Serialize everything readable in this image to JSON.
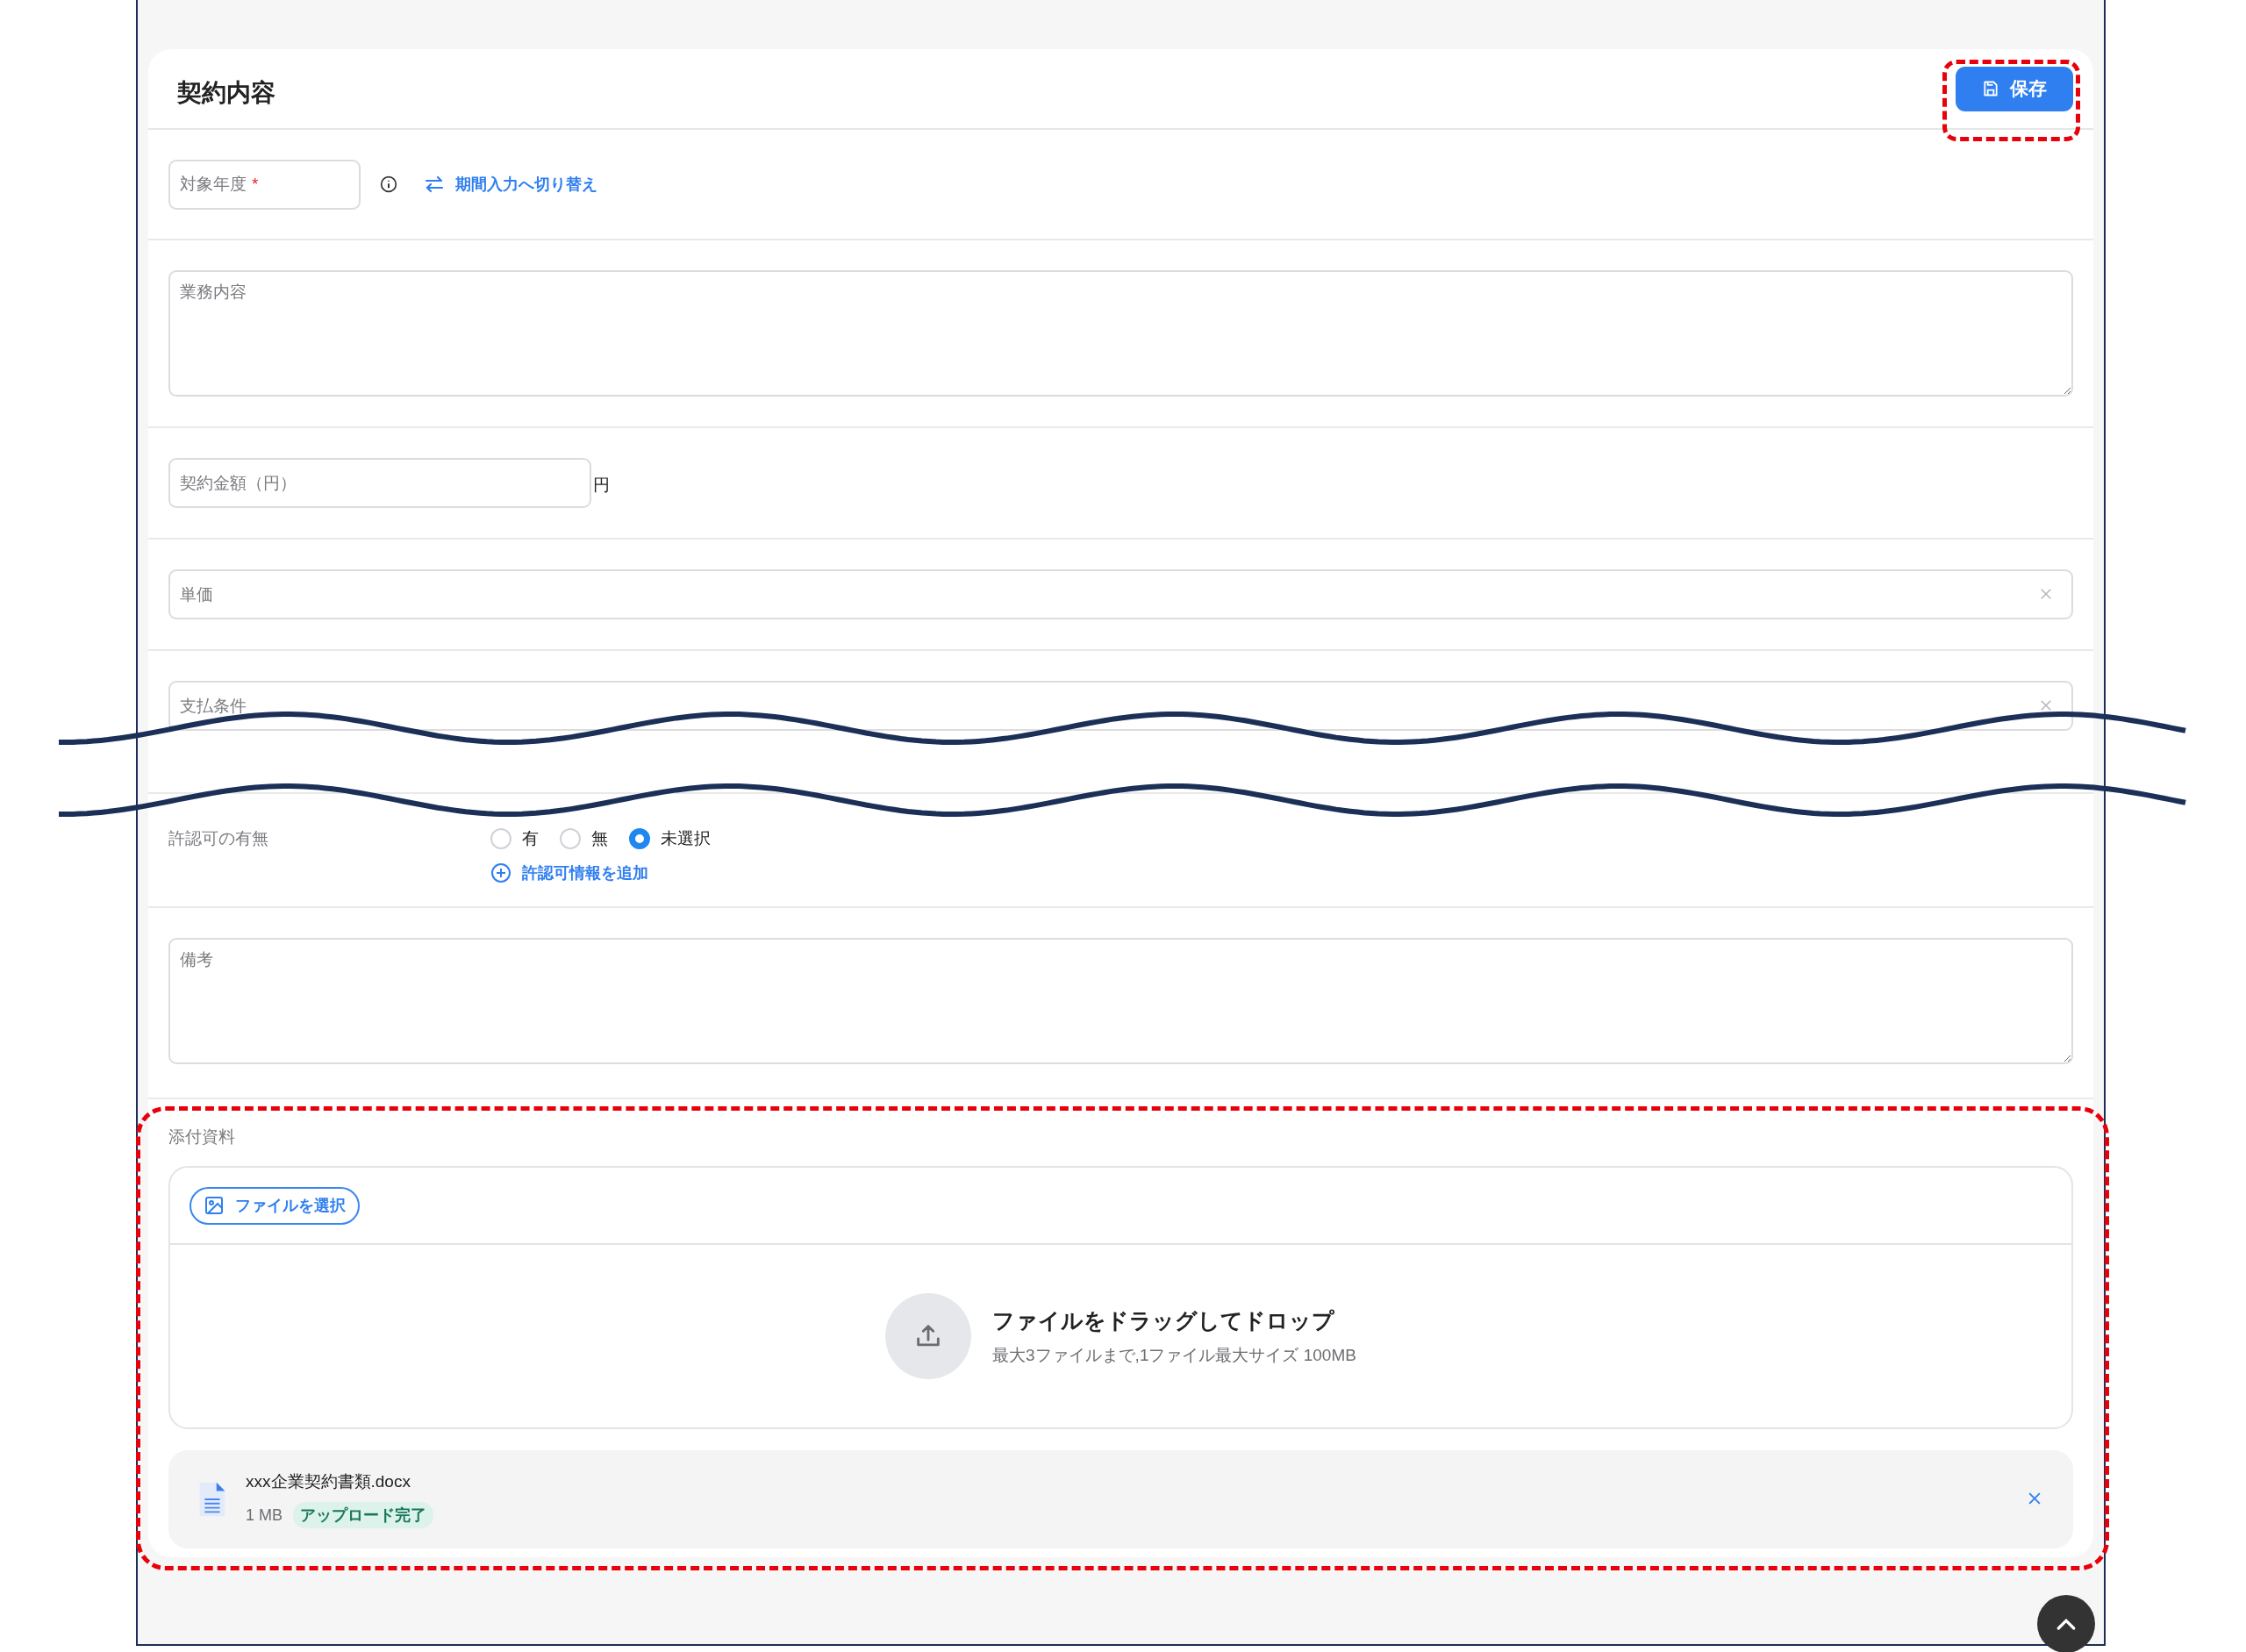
{
  "section": {
    "title": "契約内容",
    "save_button": "保存"
  },
  "target_year": {
    "placeholder": "対象年度",
    "required_mark": "*",
    "toggle_link": "期間入力へ切り替え"
  },
  "business_description": {
    "placeholder": "業務内容"
  },
  "contract_amount": {
    "placeholder": "契約金額（円）",
    "unit": "円"
  },
  "unit_price": {
    "placeholder": "単価"
  },
  "payment_terms": {
    "placeholder": "支払条件"
  },
  "permit": {
    "label": "許認可の有無",
    "options": [
      {
        "label": "有",
        "selected": false
      },
      {
        "label": "無",
        "selected": false
      },
      {
        "label": "未選択",
        "selected": true
      }
    ],
    "add_link": "許認可情報を追加"
  },
  "remarks": {
    "placeholder": "備考"
  },
  "attachments": {
    "label": "添付資料",
    "select_button": "ファイルを選択",
    "drop_title": "ファイルをドラッグしてドロップ",
    "drop_hint": "最大3ファイルまで,1ファイル最大サイズ 100MB",
    "files": [
      {
        "name": "xxx企業契約書類.docx",
        "size": "1 MB",
        "status": "アップロード完了"
      }
    ]
  }
}
